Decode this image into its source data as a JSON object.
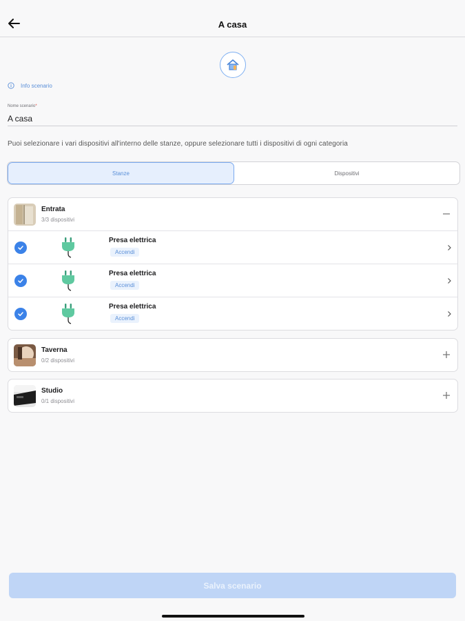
{
  "header": {
    "title": "A casa"
  },
  "info": {
    "label": "Info scenario"
  },
  "form": {
    "name_label": "Nome scenario",
    "required_mark": "*",
    "name_value": "A casa",
    "hint": "Puoi selezionare i vari dispositivi all'interno delle stanze, oppure selezionare tutti i dispositivi di ogni categoria"
  },
  "tabs": [
    {
      "label": "Stanze",
      "active": true
    },
    {
      "label": "Dispositivi",
      "active": false
    }
  ],
  "rooms": [
    {
      "name": "Entrata",
      "count": "3/3 dispositivi",
      "expanded": true,
      "devices": [
        {
          "name": "Presa elettrica",
          "action": "Accendi",
          "selected": true,
          "icon": "plug-icon"
        },
        {
          "name": "Presa elettrica",
          "action": "Accendi",
          "selected": true,
          "icon": "plug-icon"
        },
        {
          "name": "Presa elettrica",
          "action": "Accendi",
          "selected": true,
          "icon": "plug-icon"
        }
      ]
    },
    {
      "name": "Taverna",
      "count": "0/2 dispositivi",
      "expanded": false
    },
    {
      "name": "Studio",
      "count": "0/1 dispositivi",
      "expanded": false
    }
  ],
  "footer": {
    "save_label": "Salva scenario"
  },
  "colors": {
    "accent": "#3b82e8",
    "plug": "#5fc9a0",
    "save_disabled": "#bfd5f6"
  }
}
